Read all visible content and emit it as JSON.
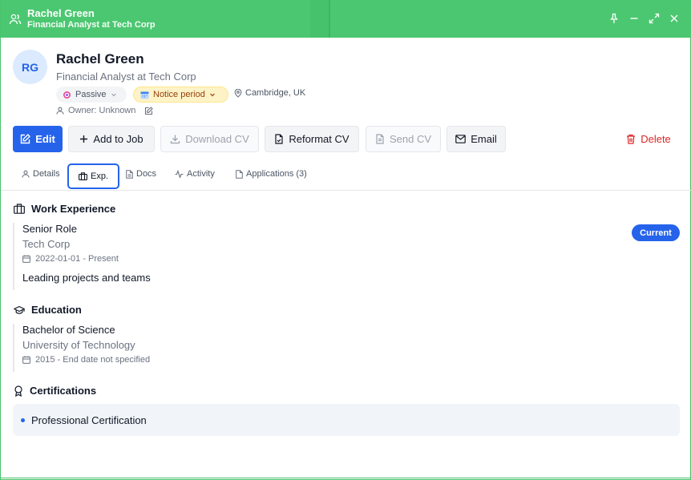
{
  "window": {
    "title": "Rachel Green",
    "subtitle": "Financial Analyst at Tech Corp",
    "accent": "#4cc771"
  },
  "header": {
    "initials": "RG",
    "name": "Rachel Green",
    "title": "Financial Analyst at Tech Corp",
    "status": "Passive",
    "availability": "Notice period",
    "location": "Cambridge, UK",
    "owner": "Owner: Unknown"
  },
  "actions": {
    "edit": "Edit",
    "add_to_job": "Add to Job",
    "download_cv": "Download CV",
    "reformat_cv": "Reformat CV",
    "send_cv": "Send CV",
    "email": "Email",
    "delete": "Delete"
  },
  "tabs": [
    {
      "label": "Details"
    },
    {
      "label": "Exp."
    },
    {
      "label": "Docs"
    },
    {
      "label": "Activity"
    },
    {
      "label": "Applications (3)"
    }
  ],
  "work_experience": {
    "heading": "Work Experience",
    "entries": [
      {
        "role": "Senior Role",
        "company": "Tech Corp",
        "dates": "2022-01-01 - Present",
        "description": "Leading projects and teams",
        "badge": "Current"
      }
    ]
  },
  "education": {
    "heading": "Education",
    "entries": [
      {
        "degree": "Bachelor of Science",
        "institution": "University of Technology",
        "dates": "2015 - End date not specified"
      }
    ]
  },
  "certifications": {
    "heading": "Certifications",
    "items": [
      "Professional Certification"
    ]
  }
}
